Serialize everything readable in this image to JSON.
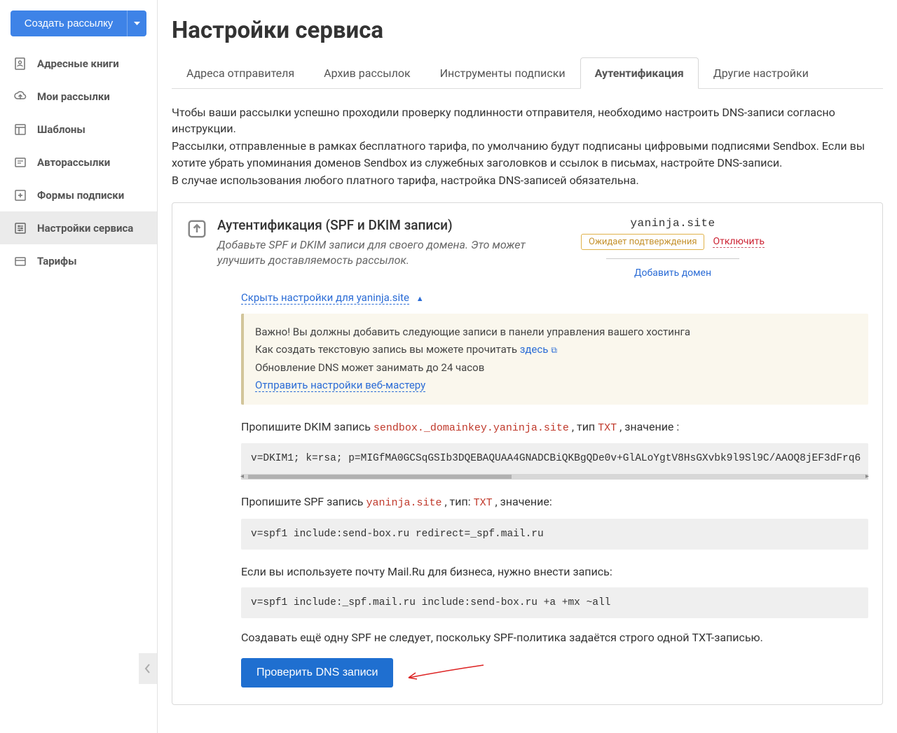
{
  "sidebar": {
    "create_label": "Создать рассылку",
    "items": [
      {
        "label": "Адресные книги"
      },
      {
        "label": "Мои рассылки"
      },
      {
        "label": "Шаблоны"
      },
      {
        "label": "Авторассылки"
      },
      {
        "label": "Формы подписки"
      },
      {
        "label": "Настройки сервиса"
      },
      {
        "label": "Тарифы"
      }
    ]
  },
  "page": {
    "title": "Настройки сервиса"
  },
  "tabs": [
    {
      "label": "Адреса отправителя"
    },
    {
      "label": "Архив рассылок"
    },
    {
      "label": "Инструменты подписки"
    },
    {
      "label": "Аутентификация"
    },
    {
      "label": "Другие настройки"
    }
  ],
  "intro": {
    "p1": "Чтобы ваши рассылки успешно проходили проверку подлинности отправителя, необходимо настроить DNS-записи согласно инструкции.",
    "p2": "Рассылки, отправленные в рамках бесплатного тарифа, по умолчанию будут подписаны цифровыми подписями Sendbox. Если вы хотите убрать упоминания доменов Sendbox из служебных заголовков и ссылок в письмах, настройте DNS-записи.",
    "p3": "В случае использования любого платного тарифа, настройка DNS-записей обязательна."
  },
  "panel": {
    "title": "Аутентификация (SPF и DKIM записи)",
    "subtitle": "Добавьте SPF и DKIM записи для своего домена. Это может улучшить доставляемость рассылок.",
    "domain": "yaninja.site",
    "badge": "Ожидает подтверждения",
    "disable": "Отключить",
    "add_domain": "Добавить домен",
    "toggle": "Скрыть настройки для yaninja.site"
  },
  "alert": {
    "l1": "Важно! Вы должны добавить следующие записи в панели управления вашего хостинга",
    "l2a": "Как создать текстовую запись вы можете прочитать ",
    "l2_link": "здесь",
    "l3": "Обновление DNS может занимать до 24 часов",
    "l4_link": "Отправить настройки веб-мастеру"
  },
  "dkim": {
    "label_before": "Пропишите DKIM запись ",
    "host": "sendbox._domainkey.yaninja.site",
    "label_mid": " , тип ",
    "type": "TXT",
    "label_after": " , значение :",
    "value": "v=DKIM1; k=rsa; p=MIGfMA0GCSqGSIb3DQEBAQUAA4GNADCBiQKBgQDe0v+GlALoYgtV8HsGXvbk9l9Sl9C/AAOQ8jEF3dFrq6"
  },
  "spf": {
    "label_before": "Пропишите SPF запись ",
    "host": "yaninja.site",
    "label_mid": " , тип: ",
    "type": "TXT",
    "label_after": " , значение:",
    "value": "v=spf1 include:send-box.ru redirect=_spf.mail.ru"
  },
  "mailru": {
    "label": "Если вы используете почту Mail.Ru для бизнеса, нужно внести запись:",
    "value": "v=spf1 include:_spf.mail.ru include:send-box.ru +a +mx ~all"
  },
  "note": "Создавать ещё одну SPF не следует, поскольку SPF-политика задаётся строго одной TXT-записью.",
  "check_btn": "Проверить DNS записи"
}
